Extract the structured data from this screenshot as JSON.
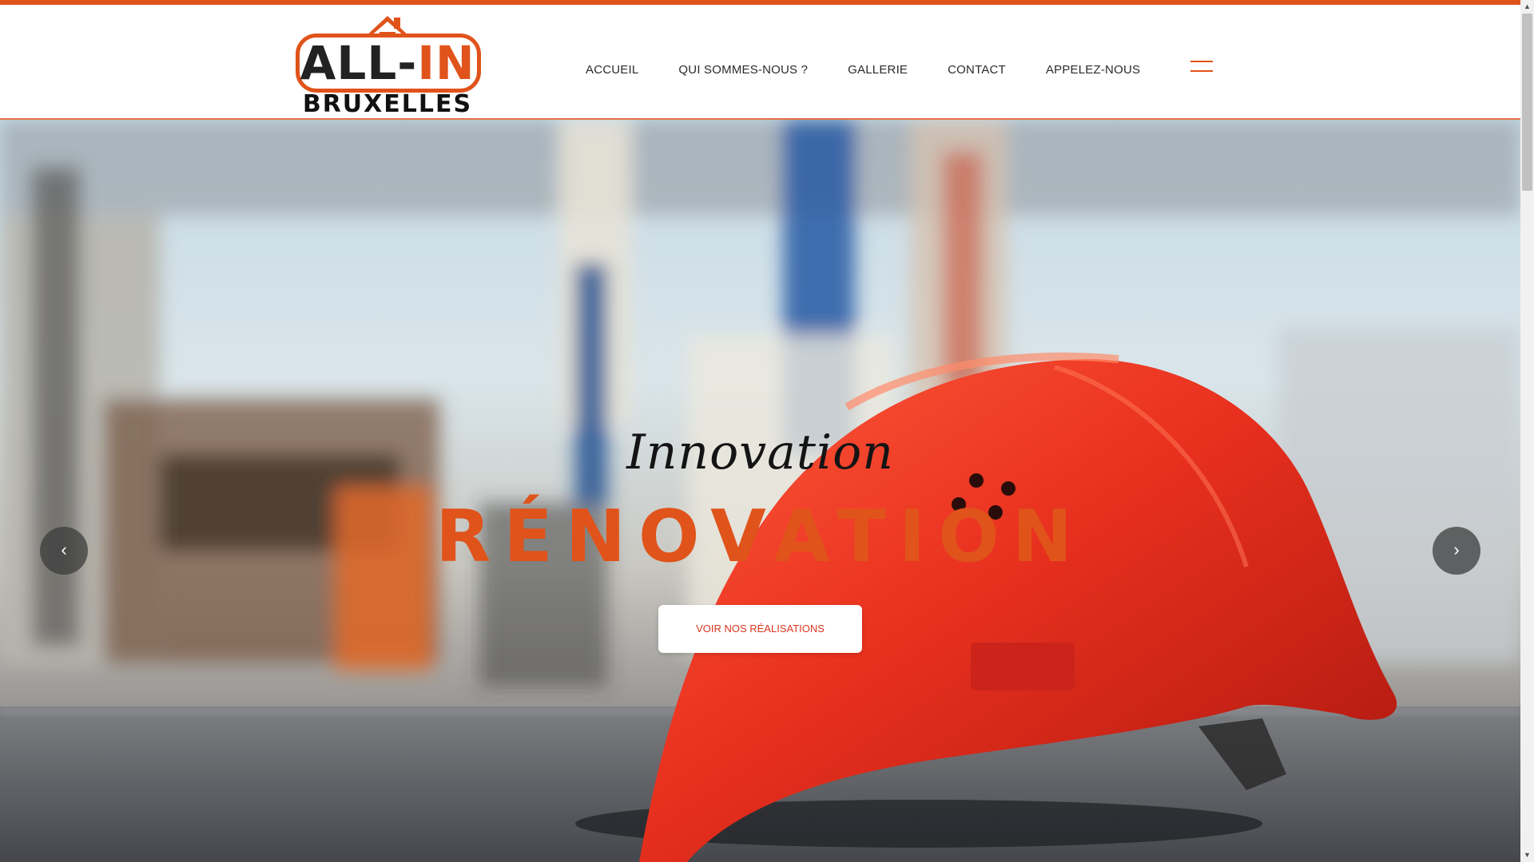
{
  "logo": {
    "main_part1": "ALL-",
    "main_part2": "IN",
    "subtitle": "BRUXELLES"
  },
  "nav": {
    "items": [
      {
        "label": "ACCUEIL"
      },
      {
        "label": "QUI SOMMES-NOUS ?"
      },
      {
        "label": "GALLERIE"
      },
      {
        "label": "CONTACT"
      },
      {
        "label": "APPELEZ-NOUS"
      }
    ],
    "menu_icon": "hamburger-icon"
  },
  "hero": {
    "script_text": "Innovation",
    "title": "RÉNOVATION",
    "button_label": "VOIR NOS RÉALISATIONS",
    "prev_icon": "‹",
    "next_icon": "›"
  },
  "colors": {
    "accent": "#e0531b",
    "button_text": "#d9361f",
    "helmet": "#e8301e"
  },
  "scrollbar": {
    "up_icon": "▲",
    "down_icon": "▼"
  }
}
